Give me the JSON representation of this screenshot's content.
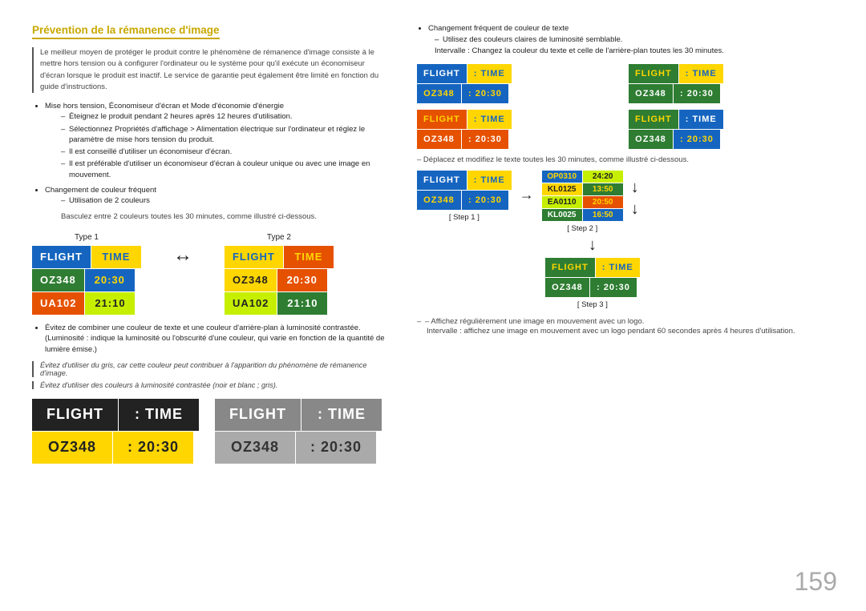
{
  "page": {
    "number": "159"
  },
  "section_title": "Prévention de la rémanence d'image",
  "intro": "Le meilleur moyen de protéger le produit contre le phénomène de rémanence d'image consiste à le mettre hors tension ou à configurer l'ordinateur ou le système pour qu'il exécute un économiseur d'écran lorsque le produit est inactif. Le service de garantie peut également être limité en fonction du guide d'instructions.",
  "bullets": [
    {
      "text": "Mise hors tension, Économiseur d'écran et Mode d'économie d'énergie",
      "dashes": [
        "Éteignez le produit pendant 2 heures après 12 heures d'utilisation.",
        "Sélectionnez Propriétés d'affichage > Alimentation électrique sur l'ordinateur et réglez le paramètre de mise hors tension du produit.",
        "Il est conseillé d'utiliser un économiseur d'écran.",
        "Il est préférable d'utiliser un économiseur d'écran à couleur unique ou avec une image en mouvement."
      ]
    },
    {
      "text": "Changement de couleur fréquent",
      "dashes": [
        "Utilisation de 2 couleurs"
      ],
      "note": "Basculez entre 2 couleurs toutes les 30 minutes, comme illustré ci-dessous."
    }
  ],
  "type_labels": [
    "Type 1",
    "Type 2"
  ],
  "flight_data": {
    "header": [
      "FLIGHT",
      "TIME"
    ],
    "rows": [
      [
        "OZ348",
        "20:30"
      ],
      [
        "UA102",
        "21:10"
      ]
    ]
  },
  "bullet2": {
    "text": "Évitez de combiner une couleur de texte et une couleur d'arrière-plan à luminosité contrastée. (Luminosité : indique la luminosité ou l'obscurité d'une couleur, qui varie en fonction de la quantité de lumière émise.)"
  },
  "italic_notes": [
    "Évitez d'utiliser du gris, car cette couleur peut contribuer à l'apparition du phénomène de rémanence d'image.",
    "Évitez d'utiliser des couleurs à luminosité contrastée (noir et blanc ; gris)."
  ],
  "bottom_boards": {
    "board1": {
      "header": [
        "FLIGHT",
        "TIME"
      ],
      "row": [
        "OZ348",
        "20:30"
      ],
      "style": "dark"
    },
    "board2": {
      "header": [
        "FLIGHT",
        "TIME"
      ],
      "row": [
        "OZ348",
        "20:30"
      ],
      "style": "gray"
    }
  },
  "right": {
    "bullet": "Changement fréquent de couleur de texte",
    "dash1": "Utilisez des couleurs claires de luminosité semblable.",
    "long_note": "Intervalle : Changez la couleur du texte et celle de l'arrière-plan toutes les 30 minutes.",
    "grid_boards": [
      {
        "header_colors": [
          "blue_hdr",
          "yellow_hdr"
        ],
        "row_colors": [
          "blue_val",
          "yellow_val"
        ]
      },
      {
        "header_colors": [
          "green_hdr",
          "yellow_hdr2"
        ],
        "row_colors": [
          "green_val",
          "yellow_val2"
        ]
      },
      {
        "header_colors": [
          "orange_hdr",
          "yellow_hdr3"
        ],
        "row_colors": [
          "orange_val",
          "yellow_val3"
        ]
      },
      {
        "header_colors": [
          "green_hdr2",
          "blue_hdr2"
        ],
        "row_colors": [
          "green_val2",
          "blue_val2"
        ]
      }
    ],
    "step_note": "– Déplacez et modifiez le texte toutes les 30 minutes, comme illustré ci-dessous.",
    "step1_label": "[ Step 1 ]",
    "step2_label": "[ Step 2 ]",
    "step3_label": "[ Step 3 ]",
    "step1_board": {
      "header": [
        "FLIGHT",
        "TIME"
      ],
      "row": [
        "OZ348",
        "20:30"
      ]
    },
    "step2_multi": [
      [
        "OP0310",
        "24:20"
      ],
      [
        "KL0125",
        "13:50"
      ],
      [
        "EA0110",
        "20:50"
      ],
      [
        "KL0025",
        "16:50"
      ]
    ],
    "step3_board": {
      "header": [
        "FLIGHT",
        "TIME"
      ],
      "row": [
        "OZ348",
        "20:30"
      ]
    },
    "final_note": "– Affichez régulièrement une image en mouvement avec un logo.",
    "final_note2": "Intervalle : affichez une image en mouvement avec un logo pendant 60 secondes après 4 heures d'utilisation."
  }
}
